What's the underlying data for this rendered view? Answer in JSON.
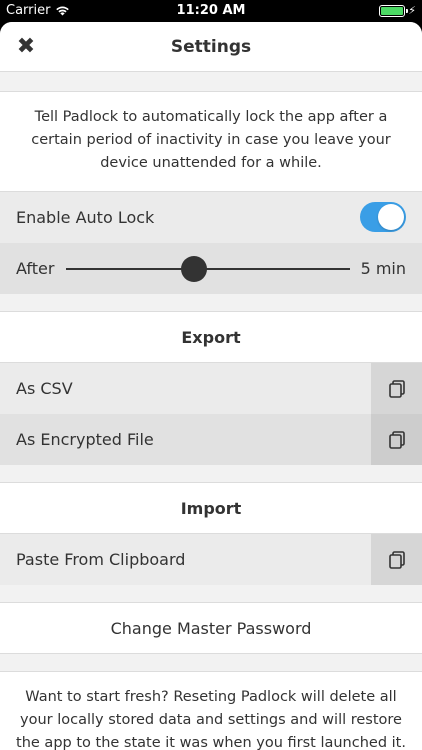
{
  "status_bar": {
    "carrier": "Carrier",
    "time": "11:20 AM",
    "battery_percent": 100
  },
  "header": {
    "title": "Settings",
    "close_icon": "close-icon"
  },
  "auto_lock": {
    "description": "Tell Padlock to automatically lock the app after a certain period of inactivity in case you leave your device unattended for a while.",
    "enable_label": "Enable Auto Lock",
    "enabled": true,
    "after_label": "After",
    "after_value": "5 min",
    "slider_fraction": 0.45
  },
  "export": {
    "title": "Export",
    "items": [
      {
        "label": "As CSV",
        "icon": "copy-icon"
      },
      {
        "label": "As Encrypted File",
        "icon": "copy-icon"
      }
    ]
  },
  "import": {
    "title": "Import",
    "items": [
      {
        "label": "Paste From Clipboard",
        "icon": "copy-icon"
      }
    ]
  },
  "change_password": {
    "label": "Change Master Password"
  },
  "reset": {
    "description": "Want to start fresh? Reseting Padlock will delete all your locally stored data and settings and will restore the app to the state it was when you first launched it."
  },
  "colors": {
    "accent": "#3a9ee6",
    "battery": "#4cd964"
  }
}
